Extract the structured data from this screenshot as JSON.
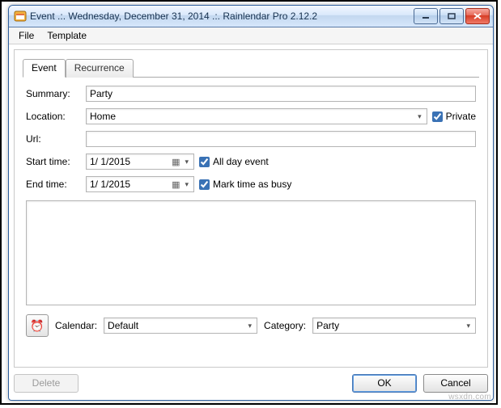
{
  "window": {
    "title": "Event .:. Wednesday, December 31, 2014 .:. Rainlendar Pro 2.12.2"
  },
  "menubar": {
    "file": "File",
    "template": "Template"
  },
  "tabs": {
    "event": "Event",
    "recurrence": "Recurrence"
  },
  "labels": {
    "summary": "Summary:",
    "location": "Location:",
    "url": "Url:",
    "start_time": "Start time:",
    "end_time": "End time:",
    "all_day": "All day event",
    "mark_busy": "Mark time as busy",
    "calendar": "Calendar:",
    "category": "Category:",
    "private": "Private"
  },
  "values": {
    "summary": "Party",
    "location": "Home",
    "url": "",
    "start_date": "1/  1/2015",
    "end_date": "1/  1/2015",
    "all_day_checked": true,
    "mark_busy_checked": true,
    "private_checked": true,
    "calendar": "Default",
    "category": "Party",
    "description": ""
  },
  "buttons": {
    "delete": "Delete",
    "ok": "OK",
    "cancel": "Cancel"
  },
  "watermark": "wsxdn.com"
}
